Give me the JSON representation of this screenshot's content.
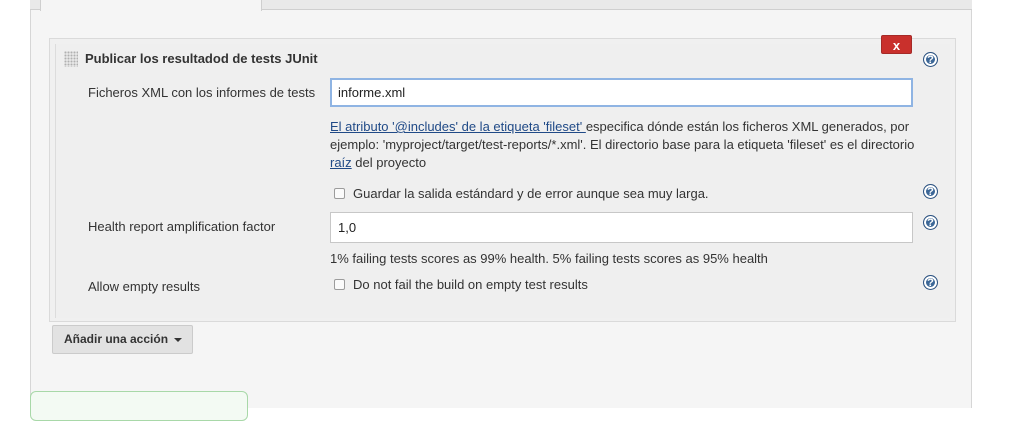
{
  "section": {
    "title": "Publicar los resultadod de tests JUnit",
    "delete_label": "x"
  },
  "fields": {
    "xml_files": {
      "label": "Ficheros XML con los informes de tests",
      "value": "informe.xml",
      "help_link_text": "El atributo '@includes' de la etiqueta 'fileset' ",
      "help_text_1": "especifica dónde están los ficheros XML generados, por ejemplo: 'myproject/target/test-reports/*.xml'. El directorio base para la etiqueta 'fileset' es el directorio ",
      "help_root_link": "raíz",
      "help_text_2": " del proyecto"
    },
    "keep_long_stdio": {
      "label": "Guardar la salida estándard y de error aunque sea muy larga.",
      "checked": false
    },
    "health_factor": {
      "label": "Health report amplification factor",
      "value": "1,0",
      "description": "1% failing tests scores as 99% health. 5% failing tests scores as 95% health"
    },
    "allow_empty": {
      "label": "Allow empty results",
      "checkbox_label": "Do not fail the build on empty test results",
      "checked": false
    }
  },
  "add_action": {
    "label": "Añadir una acción"
  },
  "icons": {
    "help": "help-icon",
    "delete": "delete-icon",
    "drag": "drag-handle-icon",
    "caret": "caret-down-icon"
  },
  "colors": {
    "delete_button": "#c9302c",
    "help_icon": "#3c6797",
    "link": "#204a87",
    "focus_border": "#8fb4e3"
  }
}
